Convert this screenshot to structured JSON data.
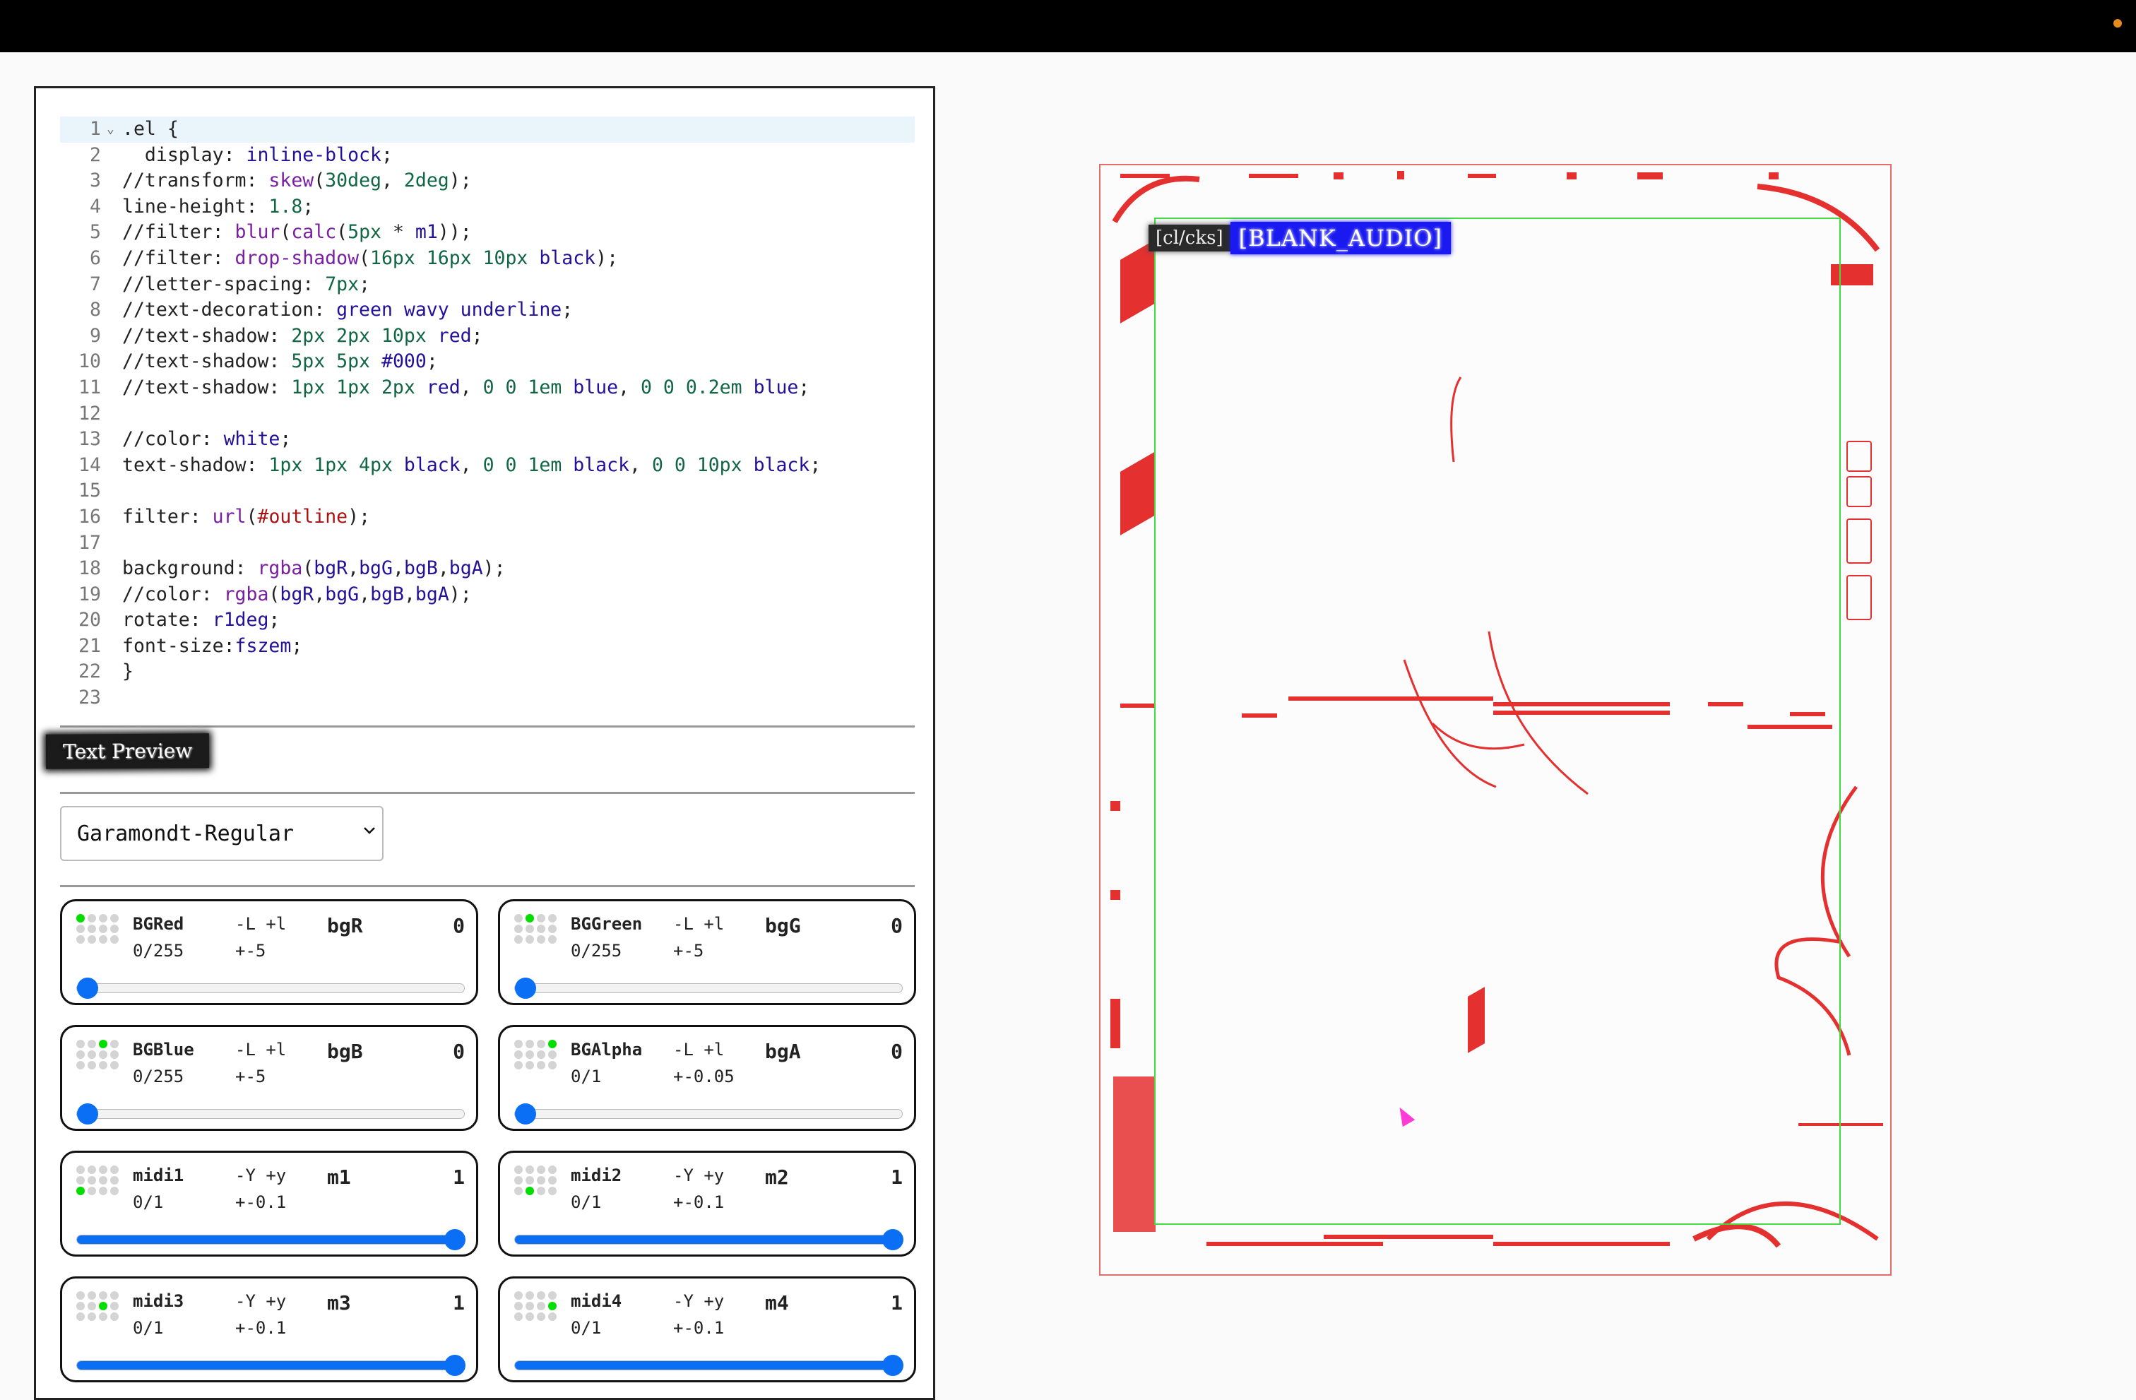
{
  "code": {
    "lines": [
      [
        {
          "t": ".el {"
        }
      ],
      [
        {
          "t": "  display: "
        },
        {
          "t": "inline-block",
          "c": "t-kw"
        },
        {
          "t": ";"
        }
      ],
      [
        {
          "t": "//transform: "
        },
        {
          "t": "skew",
          "c": "t-fn"
        },
        {
          "t": "("
        },
        {
          "t": "30deg",
          "c": "t-num"
        },
        {
          "t": ", "
        },
        {
          "t": "2deg",
          "c": "t-num"
        },
        {
          "t": ");"
        }
      ],
      [
        {
          "t": "line-height: "
        },
        {
          "t": "1.8",
          "c": "t-num"
        },
        {
          "t": ";"
        }
      ],
      [
        {
          "t": "//filter: "
        },
        {
          "t": "blur",
          "c": "t-fn"
        },
        {
          "t": "("
        },
        {
          "t": "calc",
          "c": "t-fn"
        },
        {
          "t": "("
        },
        {
          "t": "5px",
          "c": "t-num"
        },
        {
          "t": " * "
        },
        {
          "t": "m1",
          "c": "t-kw"
        },
        {
          "t": "));"
        }
      ],
      [
        {
          "t": "//filter: "
        },
        {
          "t": "drop-shadow",
          "c": "t-fn"
        },
        {
          "t": "("
        },
        {
          "t": "16px 16px 10px",
          "c": "t-num"
        },
        {
          "t": " "
        },
        {
          "t": "black",
          "c": "t-kw"
        },
        {
          "t": ");"
        }
      ],
      [
        {
          "t": "//letter-spacing: "
        },
        {
          "t": "7px",
          "c": "t-num"
        },
        {
          "t": ";"
        }
      ],
      [
        {
          "t": "//text-decoration: "
        },
        {
          "t": "green wavy underline",
          "c": "t-kw"
        },
        {
          "t": ";"
        }
      ],
      [
        {
          "t": "//text-shadow: "
        },
        {
          "t": "2px 2px 10px",
          "c": "t-num"
        },
        {
          "t": " "
        },
        {
          "t": "red",
          "c": "t-kw"
        },
        {
          "t": ";"
        }
      ],
      [
        {
          "t": "//text-shadow: "
        },
        {
          "t": "5px 5px",
          "c": "t-num"
        },
        {
          "t": " "
        },
        {
          "t": "#000",
          "c": "t-kw"
        },
        {
          "t": ";"
        }
      ],
      [
        {
          "t": "//text-shadow: "
        },
        {
          "t": "1px 1px 2px",
          "c": "t-num"
        },
        {
          "t": " "
        },
        {
          "t": "red",
          "c": "t-kw"
        },
        {
          "t": ", "
        },
        {
          "t": "0 0 1em",
          "c": "t-num"
        },
        {
          "t": " "
        },
        {
          "t": "blue",
          "c": "t-kw"
        },
        {
          "t": ", "
        },
        {
          "t": "0 0 0.2em",
          "c": "t-num"
        },
        {
          "t": " "
        },
        {
          "t": "blue",
          "c": "t-kw"
        },
        {
          "t": ";"
        }
      ],
      [
        {
          "t": ""
        }
      ],
      [
        {
          "t": "//color: "
        },
        {
          "t": "white",
          "c": "t-kw"
        },
        {
          "t": ";"
        }
      ],
      [
        {
          "t": "text-shadow: "
        },
        {
          "t": "1px 1px 4px",
          "c": "t-num"
        },
        {
          "t": " "
        },
        {
          "t": "black",
          "c": "t-kw"
        },
        {
          "t": ", "
        },
        {
          "t": "0 0 1em",
          "c": "t-num"
        },
        {
          "t": " "
        },
        {
          "t": "black",
          "c": "t-kw"
        },
        {
          "t": ", "
        },
        {
          "t": "0 0 10px",
          "c": "t-num"
        },
        {
          "t": " "
        },
        {
          "t": "black",
          "c": "t-kw"
        },
        {
          "t": ";"
        }
      ],
      [
        {
          "t": ""
        }
      ],
      [
        {
          "t": "filter: "
        },
        {
          "t": "url",
          "c": "t-fn"
        },
        {
          "t": "("
        },
        {
          "t": "#outline",
          "c": "t-str"
        },
        {
          "t": ");"
        }
      ],
      [
        {
          "t": ""
        }
      ],
      [
        {
          "t": "background: "
        },
        {
          "t": "rgba",
          "c": "t-fn"
        },
        {
          "t": "("
        },
        {
          "t": "bgR",
          "c": "t-kw"
        },
        {
          "t": ","
        },
        {
          "t": "bgG",
          "c": "t-kw"
        },
        {
          "t": ","
        },
        {
          "t": "bgB",
          "c": "t-kw"
        },
        {
          "t": ","
        },
        {
          "t": "bgA",
          "c": "t-kw"
        },
        {
          "t": ");"
        }
      ],
      [
        {
          "t": "//color: "
        },
        {
          "t": "rgba",
          "c": "t-fn"
        },
        {
          "t": "("
        },
        {
          "t": "bgR",
          "c": "t-kw"
        },
        {
          "t": ","
        },
        {
          "t": "bgG",
          "c": "t-kw"
        },
        {
          "t": ","
        },
        {
          "t": "bgB",
          "c": "t-kw"
        },
        {
          "t": ","
        },
        {
          "t": "bgA",
          "c": "t-kw"
        },
        {
          "t": ");"
        }
      ],
      [
        {
          "t": "rotate: "
        },
        {
          "t": "r1deg",
          "c": "t-kw"
        },
        {
          "t": ";"
        }
      ],
      [
        {
          "t": "font-size:"
        },
        {
          "t": "fszem",
          "c": "t-kw"
        },
        {
          "t": ";"
        }
      ],
      [
        {
          "t": "}"
        }
      ],
      [
        {
          "t": ""
        }
      ]
    ]
  },
  "preview_label": "Text Preview",
  "font_select": {
    "value": "Garamondt-Regular"
  },
  "controls": [
    {
      "name": "BGRed",
      "range": "0/255",
      "keys": "-L +l",
      "step": "+-5",
      "var": "bgR",
      "value": "0",
      "fraction": 0,
      "dots": [
        0
      ]
    },
    {
      "name": "BGGreen",
      "range": "0/255",
      "keys": "-L +l",
      "step": "+-5",
      "var": "bgG",
      "value": "0",
      "fraction": 0,
      "dots": [
        1
      ]
    },
    {
      "name": "BGBlue",
      "range": "0/255",
      "keys": "-L +l",
      "step": "+-5",
      "var": "bgB",
      "value": "0",
      "fraction": 0,
      "dots": [
        2
      ]
    },
    {
      "name": "BGAlpha",
      "range": "0/1",
      "keys": "-L +l",
      "step": "+-0.05",
      "var": "bgA",
      "value": "0",
      "fraction": 0,
      "dots": [
        3
      ]
    },
    {
      "name": "midi1",
      "range": "0/1",
      "keys": "-Y +y",
      "step": "+-0.1",
      "var": "m1",
      "value": "1",
      "fraction": 1,
      "dots": [
        8
      ]
    },
    {
      "name": "midi2",
      "range": "0/1",
      "keys": "-Y +y",
      "step": "+-0.1",
      "var": "m2",
      "value": "1",
      "fraction": 1,
      "dots": [
        9
      ]
    },
    {
      "name": "midi3",
      "range": "0/1",
      "keys": "-Y +y",
      "step": "+-0.1",
      "var": "m3",
      "value": "1",
      "fraction": 1,
      "dots": [
        6
      ]
    },
    {
      "name": "midi4",
      "range": "0/1",
      "keys": "-Y +y",
      "step": "+-0.1",
      "var": "m4",
      "value": "1",
      "fraction": 1,
      "dots": [
        7
      ]
    }
  ],
  "preview": {
    "caption_left": "[cl/cks]",
    "caption_right": "[BLANK_AUDIO]"
  }
}
